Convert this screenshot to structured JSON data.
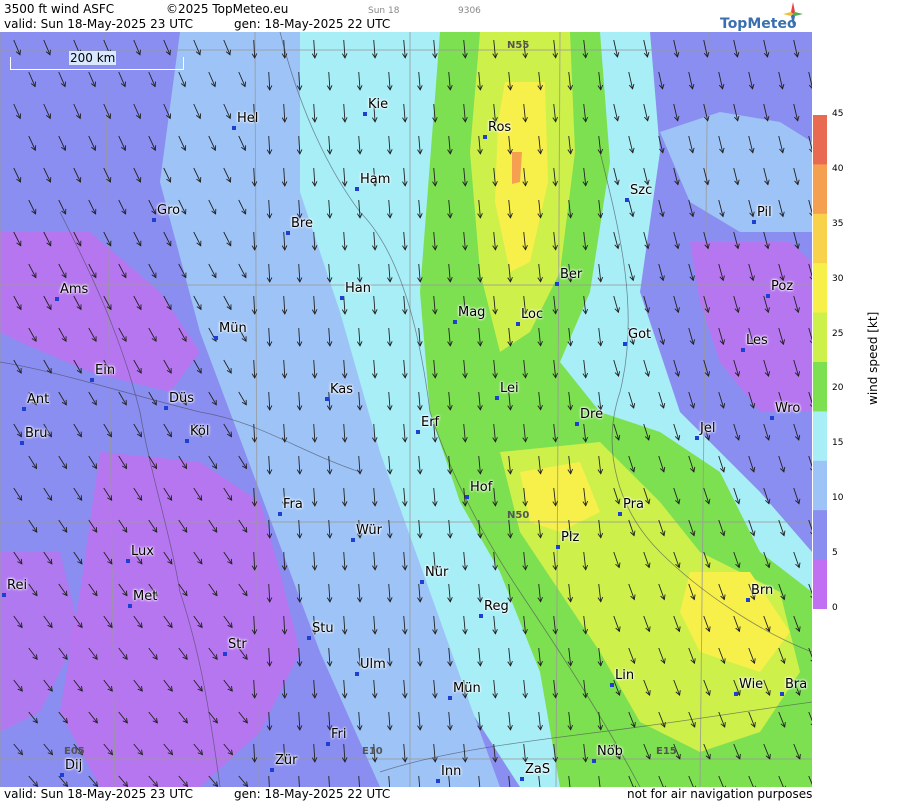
{
  "header": {
    "product": "3500 ft wind ASFC",
    "copyright": "©2025 TopMeteo.eu",
    "valid": "valid:  Sun  18-May-2025  23 UTC",
    "gen": "gen: 18-May-2025 22 UTC",
    "small_day": "Sun 18",
    "small_code": "9306"
  },
  "footer": {
    "valid": "valid:  Sun  18-May-2025  23 UTC",
    "gen": "gen: 18-May-2025 22 UTC",
    "disclaimer": "not for air navigation purposes"
  },
  "logo": {
    "text": "TopMeteo",
    "icon": "compass-star-icon"
  },
  "scale": {
    "label": "200 km"
  },
  "grid_labels": [
    "N55",
    "N50",
    "E05",
    "E10",
    "E15"
  ],
  "legend": {
    "title": "wind speed [kt]",
    "ticks": [
      "45",
      "40",
      "35",
      "30",
      "25",
      "20",
      "15",
      "10",
      "5",
      "0"
    ],
    "colors": [
      "#e86a50",
      "#f4a050",
      "#f7d24a",
      "#f7f04a",
      "#cdf04a",
      "#7de050",
      "#a8eef7",
      "#9ec4f7",
      "#8a8ef0",
      "#c070f0"
    ]
  },
  "cities": [
    {
      "name": "Kie"
    },
    {
      "name": "Hel"
    },
    {
      "name": "Ros"
    },
    {
      "name": "Ham"
    },
    {
      "name": "Szc"
    },
    {
      "name": "Gro"
    },
    {
      "name": "Bre"
    },
    {
      "name": "Pil"
    },
    {
      "name": "Ber"
    },
    {
      "name": "Ams"
    },
    {
      "name": "Han"
    },
    {
      "name": "Poz"
    },
    {
      "name": "Mag"
    },
    {
      "name": "Loc"
    },
    {
      "name": "Mün"
    },
    {
      "name": "Got"
    },
    {
      "name": "Les"
    },
    {
      "name": "Ein"
    },
    {
      "name": "Lei"
    },
    {
      "name": "Kas"
    },
    {
      "name": "Ant"
    },
    {
      "name": "Düs"
    },
    {
      "name": "Dre"
    },
    {
      "name": "Wro"
    },
    {
      "name": "Erf"
    },
    {
      "name": "Bru"
    },
    {
      "name": "Köl"
    },
    {
      "name": "Jel"
    },
    {
      "name": "Hof"
    },
    {
      "name": "Fra"
    },
    {
      "name": "Pra"
    },
    {
      "name": "Wür"
    },
    {
      "name": "Plz"
    },
    {
      "name": "Lux"
    },
    {
      "name": "Nür"
    },
    {
      "name": "Rei"
    },
    {
      "name": "Met"
    },
    {
      "name": "Reg"
    },
    {
      "name": "Brn"
    },
    {
      "name": "Stu"
    },
    {
      "name": "Str"
    },
    {
      "name": "Ulm"
    },
    {
      "name": "Lin"
    },
    {
      "name": "Wie"
    },
    {
      "name": "Bra"
    },
    {
      "name": "Mün"
    },
    {
      "name": "Fri"
    },
    {
      "name": "Nöb"
    },
    {
      "name": "Dij"
    },
    {
      "name": "Zür"
    },
    {
      "name": "Inn"
    },
    {
      "name": "ZaS"
    }
  ]
}
